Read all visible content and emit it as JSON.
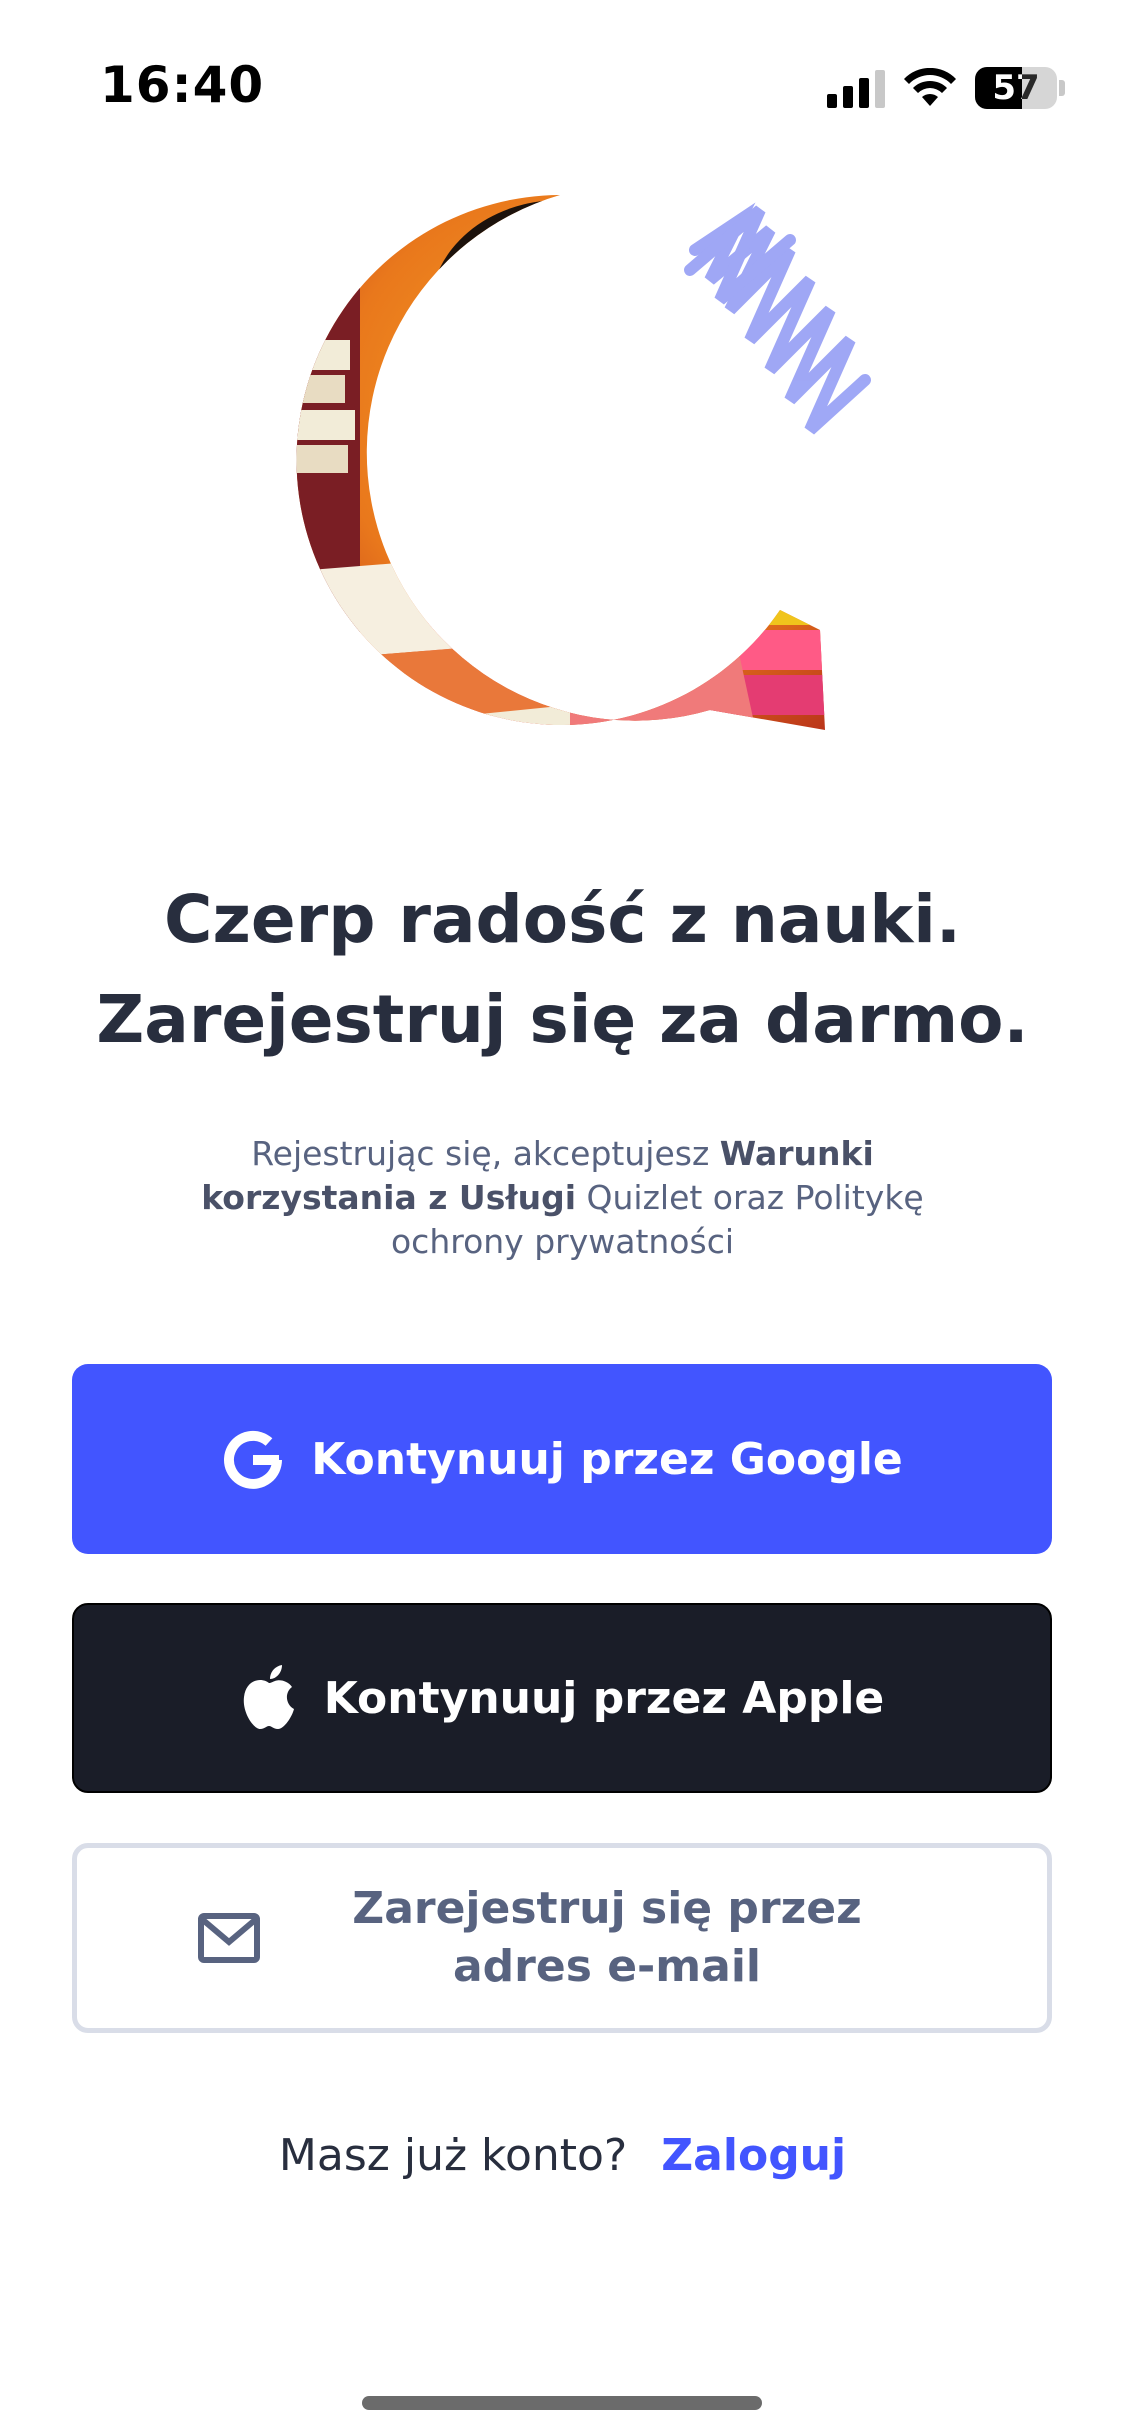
{
  "status_bar": {
    "time": "16:40",
    "battery_percent": "57",
    "battery_level": 0.57,
    "icons": [
      "cellular-signal-icon",
      "wifi-icon",
      "battery-icon"
    ]
  },
  "hero": {
    "icon": "student-with-phone-illustration"
  },
  "headline": {
    "line1": "Czerp radość z nauki.",
    "line2": "Zarejestruj się za darmo."
  },
  "terms": {
    "prefix": "Rejestrując się, akceptujesz ",
    "terms_link": "Warunki korzystania z Usługi",
    "middle": " Quizlet oraz ",
    "privacy_link": "Politykę ochrony prywatności"
  },
  "buttons": {
    "google_label": "Kontynuuj przez Google",
    "apple_label": "Kontynuuj przez Apple",
    "email_label": "Zarejestruj się przez adres e-mail"
  },
  "login": {
    "prompt": "Masz już konto?",
    "link": "Zaloguj"
  },
  "colors": {
    "primary": "#4255ff",
    "apple_bg": "#1a1d28",
    "text_dark": "#282e3e",
    "text_muted": "#586380"
  }
}
